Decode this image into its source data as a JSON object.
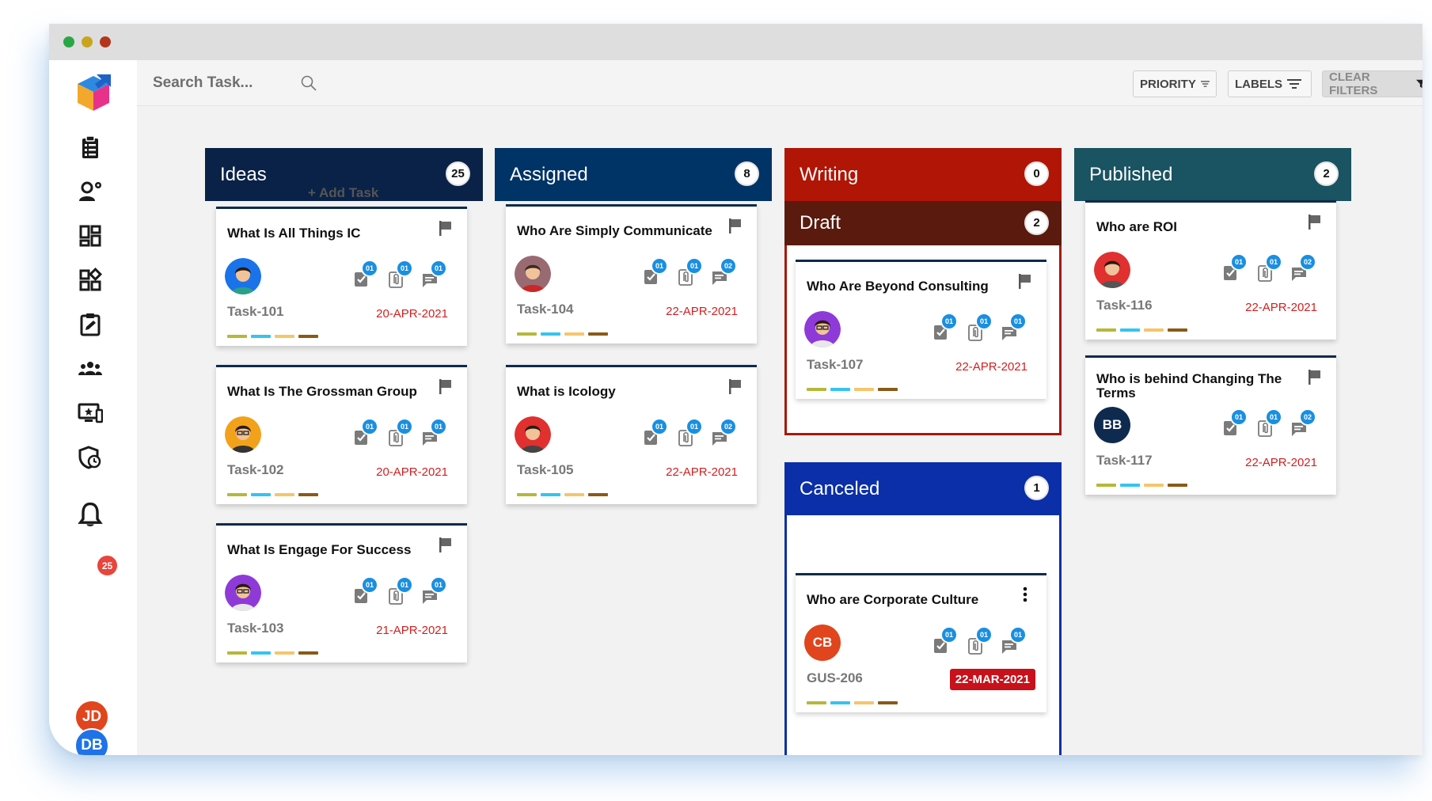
{
  "search": {
    "placeholder": "Search Task..."
  },
  "filters": {
    "priority": "PRIORITY",
    "labels": "LABELS",
    "clear": "CLEAR FILTERS"
  },
  "sidebar": {
    "icons": [
      "clipboard-list-icon",
      "user-settings-icon",
      "dashboard-icon",
      "widgets-icon",
      "edit-task-icon",
      "team-icon",
      "monitor-star-icon",
      "shield-clock-icon",
      "bell-icon"
    ],
    "notification_count": "25",
    "users": [
      "JD",
      "DB"
    ]
  },
  "label_colors": [
    "#b5b83a",
    "#34c4ef",
    "#f6c56a",
    "#8a5a17"
  ],
  "columns": {
    "ideas": {
      "title": "Ideas",
      "count": "25",
      "color": "#0a2247",
      "add_task": "+ Add Task"
    },
    "assigned": {
      "title": "Assigned",
      "count": "8",
      "color": "#003366"
    },
    "writing": {
      "title": "Writing",
      "count": "0",
      "color": "#b01506"
    },
    "draft": {
      "title": "Draft",
      "count": "2",
      "color": "#5a1a0e"
    },
    "canceled": {
      "title": "Canceled",
      "count": "1",
      "color": "#0a2fa8"
    },
    "published": {
      "title": "Published",
      "count": "2",
      "color": "#1a5361"
    }
  },
  "cards": {
    "c101": {
      "title": "What Is All Things IC",
      "id": "Task-101",
      "date": "20-APR-2021",
      "checks": "01",
      "attachments": "01",
      "comments": "01"
    },
    "c102": {
      "title": "What Is The Grossman Group",
      "id": "Task-102",
      "date": "20-APR-2021",
      "checks": "01",
      "attachments": "01",
      "comments": "01"
    },
    "c103": {
      "title": "What Is Engage For Success",
      "id": "Task-103",
      "date": "21-APR-2021",
      "checks": "01",
      "attachments": "01",
      "comments": "01"
    },
    "c104": {
      "title": "Who Are Simply Communicate",
      "id": "Task-104",
      "date": "22-APR-2021",
      "checks": "01",
      "attachments": "01",
      "comments": "02"
    },
    "c105": {
      "title": "What is Icology",
      "id": "Task-105",
      "date": "22-APR-2021",
      "checks": "01",
      "attachments": "01",
      "comments": "02"
    },
    "c107": {
      "title": "Who Are Beyond Consulting",
      "id": "Task-107",
      "date": "22-APR-2021",
      "checks": "01",
      "attachments": "01",
      "comments": "01"
    },
    "c206": {
      "title": "Who are Corporate Culture",
      "id": "GUS-206",
      "date": "22-MAR-2021",
      "initials": "CB",
      "checks": "01",
      "attachments": "01",
      "comments": "01"
    },
    "c116": {
      "title": "Who are ROI",
      "id": "Task-116",
      "date": "22-APR-2021",
      "checks": "01",
      "attachments": "01",
      "comments": "02"
    },
    "c117": {
      "title": "Who is behind Changing The Terms",
      "id": "Task-117",
      "date": "22-APR-2021",
      "initials": "BB",
      "checks": "01",
      "attachments": "01",
      "comments": "02"
    }
  }
}
